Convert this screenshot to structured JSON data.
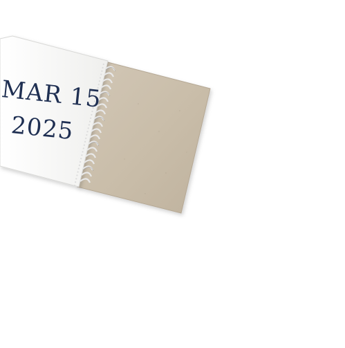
{
  "notebook": {
    "date_line_1": "MAR 15",
    "date_line_2": "2025",
    "text_color": "#1f2f52",
    "page_color": "#f6f6f4",
    "cover_color": "#c8bcaa",
    "spiral_color": "#e9e9e9"
  }
}
